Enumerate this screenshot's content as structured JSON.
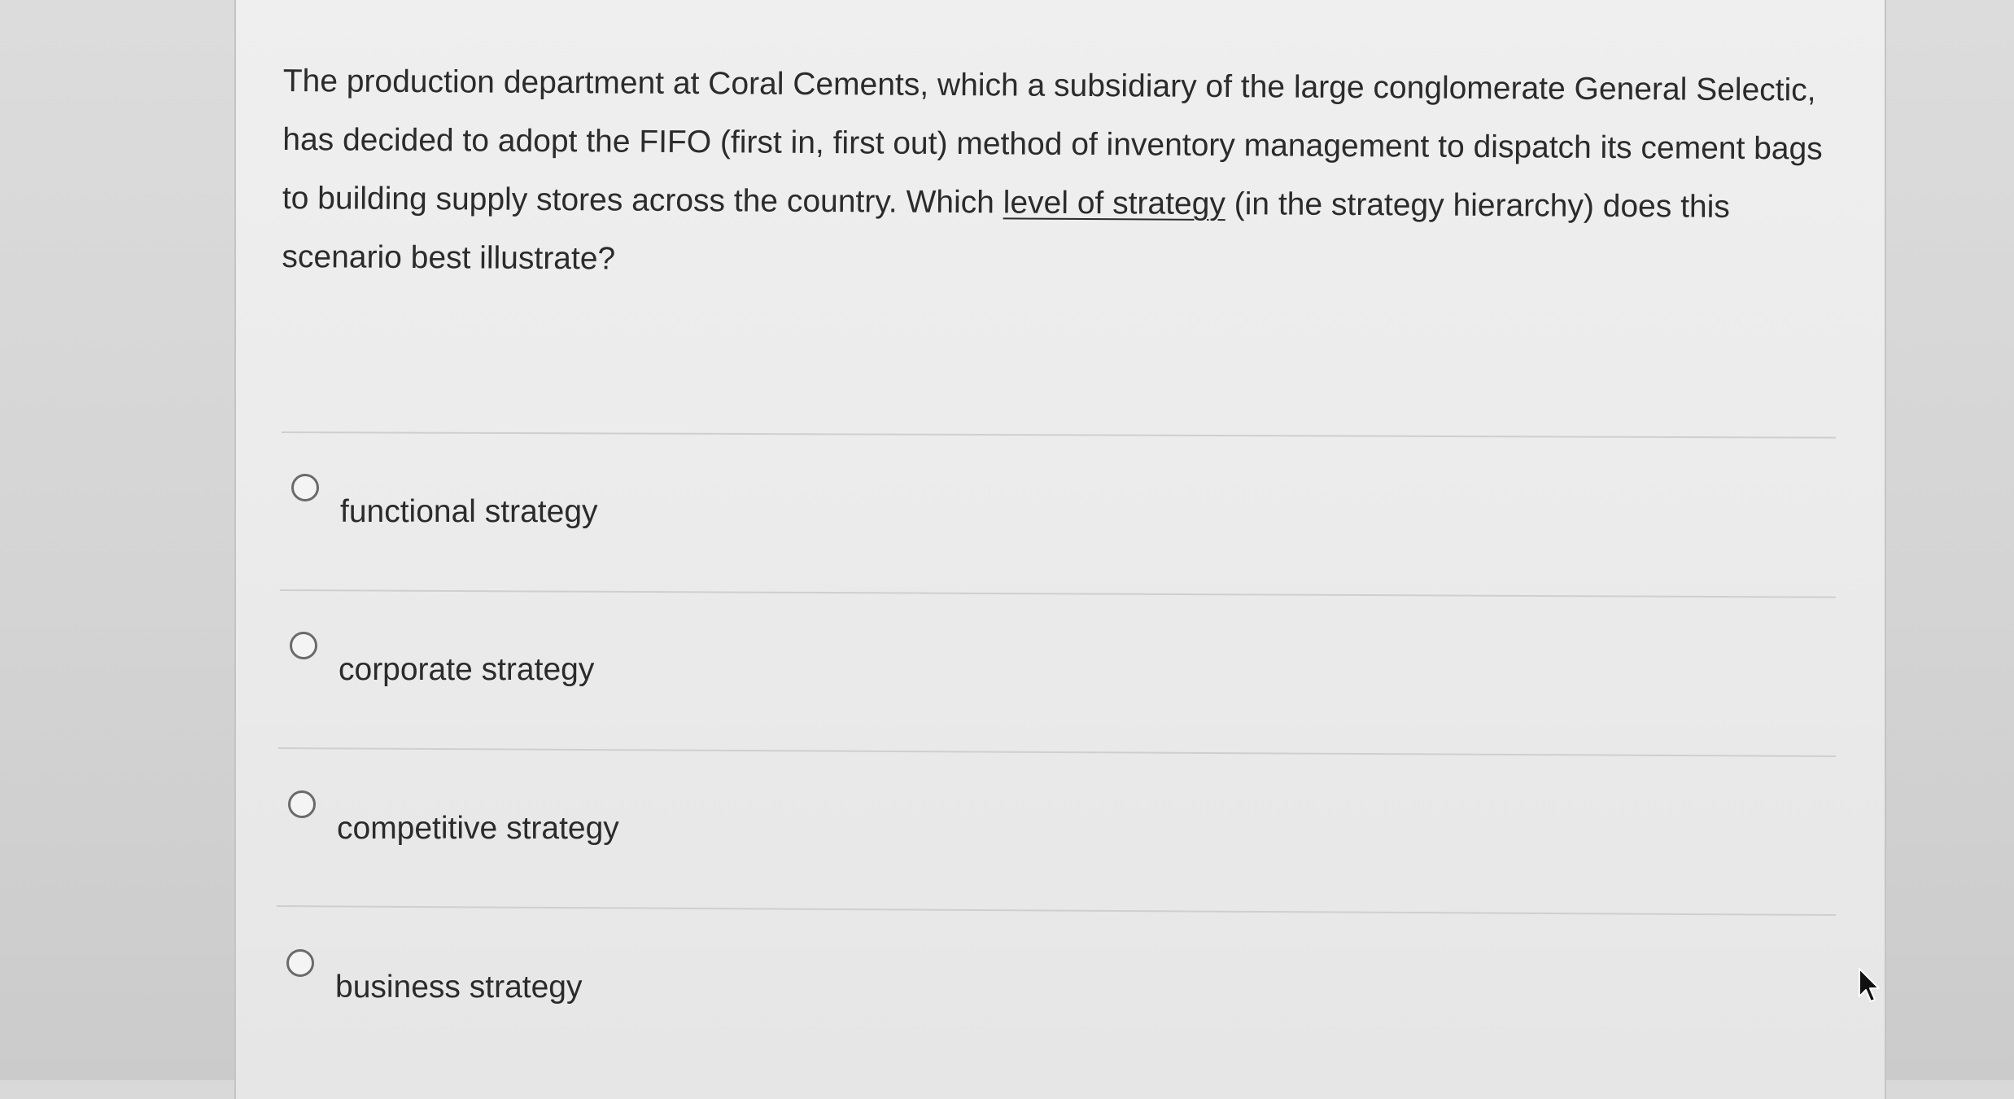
{
  "question": {
    "text_before_link": "The production department at Coral Cements, which a subsidiary of the large conglomerate General Selectic, has decided to adopt the FIFO (first in, first out) method of inventory management to dispatch its cement bags to building supply stores across the country. Which ",
    "link_text": "level of strategy",
    "text_after_link": " (in the strategy hierarchy) does this scenario best illustrate?"
  },
  "options": [
    {
      "label": "functional strategy",
      "selected": false
    },
    {
      "label": "corporate strategy",
      "selected": false
    },
    {
      "label": "competitive strategy",
      "selected": false
    },
    {
      "label": "business strategy",
      "selected": false
    }
  ],
  "icons": {
    "radio": "radio-circle-icon",
    "cursor": "mouse-pointer-icon"
  },
  "colors": {
    "background": "#d9d9d9",
    "panel": "#ececec",
    "text": "#2b2b2b",
    "divider": "#cfcfcf",
    "radio_border": "#6a6a6a"
  }
}
